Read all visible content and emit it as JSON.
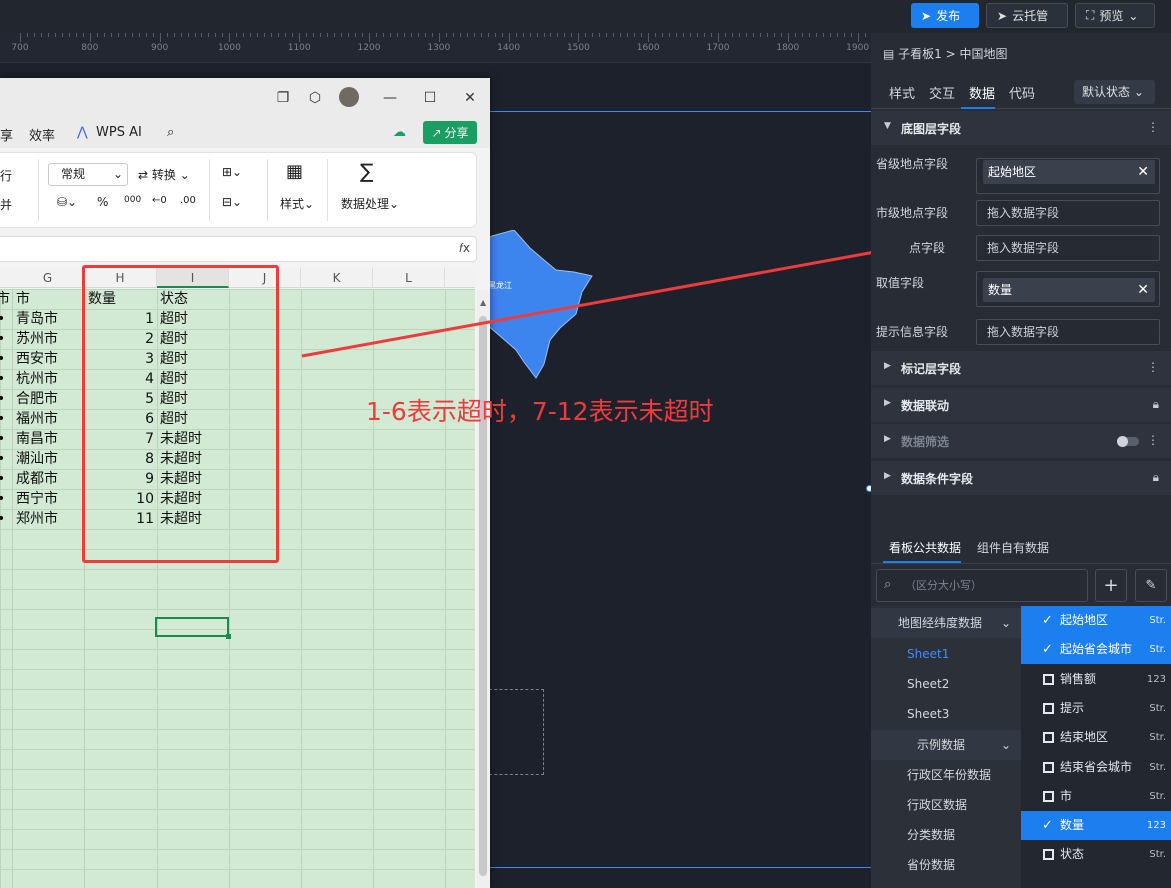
{
  "topbar": {
    "publish": "发布",
    "cloud": "云托管",
    "preview": "预览"
  },
  "ruler": {
    "labels": [
      "700",
      "800",
      "900",
      "1000",
      "1100",
      "1200",
      "1300",
      "1400",
      "1500",
      "1600",
      "1700",
      "1800",
      "1900"
    ]
  },
  "map": {
    "province_label": "黑龙江"
  },
  "wps": {
    "menu": {
      "share_partial": "享",
      "efficiency": "效率",
      "wps_ai": "WPS AI",
      "share_btn": "分享"
    },
    "ribbon": {
      "row_partial": "行",
      "merge_partial": "并",
      "format": "常规",
      "convert": "转换",
      "percent": "%",
      "thousands": "000",
      "style": "样式",
      "data_proc": "数据处理"
    },
    "columns": [
      "G",
      "H",
      "I",
      "J",
      "K",
      "L"
    ],
    "header_row": {
      "f": "市",
      "g": "市",
      "h": "数量",
      "i": "状态"
    },
    "rows": [
      {
        "city": "青岛市",
        "num": "1",
        "status": "超时"
      },
      {
        "city": "苏州市",
        "num": "2",
        "status": "超时"
      },
      {
        "city": "西安市",
        "num": "3",
        "status": "超时"
      },
      {
        "city": "杭州市",
        "num": "4",
        "status": "超时"
      },
      {
        "city": "合肥市",
        "num": "5",
        "status": "超时"
      },
      {
        "city": "福州市",
        "num": "6",
        "status": "超时"
      },
      {
        "city": "南昌市",
        "num": "7",
        "status": "未超时"
      },
      {
        "city": "潮汕市",
        "num": "8",
        "status": "未超时"
      },
      {
        "city": "成都市",
        "num": "9",
        "status": "未超时"
      },
      {
        "city": "西宁市",
        "num": "10",
        "status": "未超时"
      },
      {
        "city": "郑州市",
        "num": "11",
        "status": "未超时"
      }
    ]
  },
  "annotation": "1-6表示超时，7-12表示未超时",
  "panel": {
    "breadcrumb": "子看板1 > 中国地图",
    "tabs": [
      "样式",
      "交互",
      "数据",
      "代码"
    ],
    "state": "默认状态",
    "sections": {
      "base": "底图层字段",
      "marker": "标记层字段",
      "linkage": "数据联动",
      "filter": "数据筛选",
      "condition": "数据条件字段"
    },
    "fields": {
      "province_label": "省级地点字段",
      "province_value": "起始地区",
      "city_label": "市级地点字段",
      "city_placeholder": "拖入数据字段",
      "district_label": "点字段",
      "district_placeholder": "拖入数据字段",
      "value_label": "取值字段",
      "value_value": "数量",
      "tip_label": "提示信息字段",
      "tip_placeholder": "拖入数据字段"
    },
    "data_tabs": [
      "看板公共数据",
      "组件自有数据"
    ],
    "search_placeholder": "（区分大小写）",
    "tree": [
      "地图经纬度数据",
      "Sheet1",
      "Sheet2",
      "Sheet3",
      "示例数据",
      "行政区年份数据",
      "行政区数据",
      "分类数据",
      "省份数据"
    ],
    "field_list": [
      {
        "name": "起始地区",
        "type": "Str.",
        "checked": true
      },
      {
        "name": "起始省会城市",
        "type": "Str.",
        "checked": true
      },
      {
        "name": "销售额",
        "type": "123",
        "checked": false
      },
      {
        "name": "提示",
        "type": "Str.",
        "checked": false
      },
      {
        "name": "结束地区",
        "type": "Str.",
        "checked": false
      },
      {
        "name": "结束省会城市",
        "type": "Str.",
        "checked": false
      },
      {
        "name": "市",
        "type": "Str.",
        "checked": false
      },
      {
        "name": "数量",
        "type": "123",
        "checked": true
      },
      {
        "name": "状态",
        "type": "Str.",
        "checked": false
      }
    ]
  },
  "colors": {
    "accent": "#1c7ff0",
    "annotation_red": "#ef3b3b",
    "sheet_green": "#d2e9d3",
    "wps_green": "#1b9e61"
  }
}
